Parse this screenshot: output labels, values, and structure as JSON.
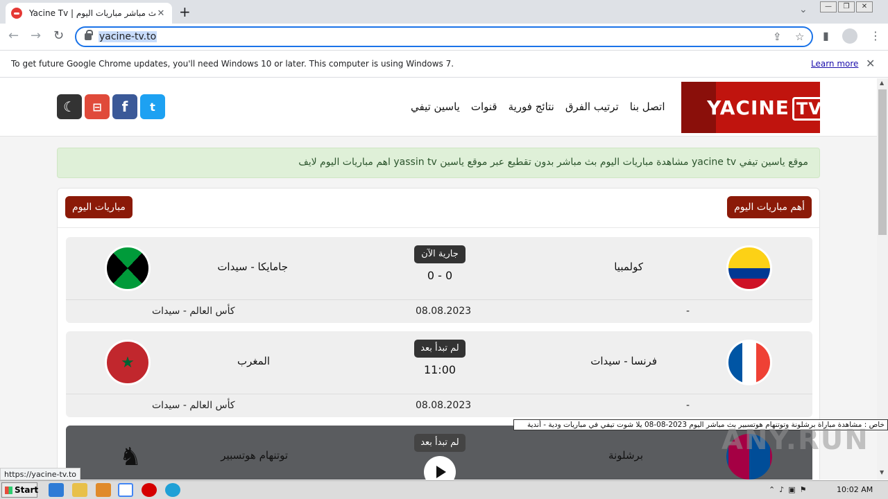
{
  "browser": {
    "tab_title": "Yacine Tv | ياسين تيفي بث مباشر مباريات اليوم",
    "tab_close": "✕",
    "new_tab": "+",
    "url": "yacine-tv.to",
    "infobar_message": "To get future Google Chrome updates, you'll need Windows 10 or later. This computer is using Windows 7.",
    "infobar_link": "Learn more",
    "infobar_close": "✕"
  },
  "site": {
    "logo_text": "YACINE",
    "logo_tv": "TV",
    "menu": [
      "ياسين تيفي",
      "قنوات",
      "نتائج فورية",
      "ترتيب الفرق",
      "اتصل بنا"
    ],
    "notice": "موقع ياسين تيفي yacine tv مشاهدة مباريات اليوم بث مباشر بدون تقطيع عبر موقع ياسين yassin tv اهم مباريات اليوم لايف",
    "section_left": "مباريات اليوم",
    "section_right": "أهم مباريات اليوم",
    "colors": {
      "brand": "#c0140e",
      "pill": "#8b1a08"
    }
  },
  "matches": [
    {
      "home": "كولمبيا",
      "away": "جامايكا - سيدات",
      "status": "جارية الآن",
      "score": "0 - 0",
      "date": "08.08.2023",
      "competition": "كأس العالم - سيدات",
      "channel": "-"
    },
    {
      "home": "فرنسا - سيدات",
      "away": "المغرب",
      "status": "لم تبدأ بعد",
      "score": "11:00",
      "date": "08.08.2023",
      "competition": "كأس العالم - سيدات",
      "channel": "-"
    },
    {
      "home": "برشلونة",
      "away": "توتنهام هوتسبير",
      "status": "لم تبدأ بعد",
      "score": "",
      "date": "",
      "competition": "",
      "channel": ""
    }
  ],
  "overlay": {
    "ticker": "خاص : مشاهدة مباراة برشلونة وتوتنهام هوتسبير بث مباشر اليوم 2023-08-08 يلا شوت تيفي في  مباريات ودية - أندية",
    "watermark": "ANY.RUN",
    "status_url": "https://yacine-tv.to"
  },
  "taskbar": {
    "start": "Start",
    "clock": "10:02 AM"
  }
}
